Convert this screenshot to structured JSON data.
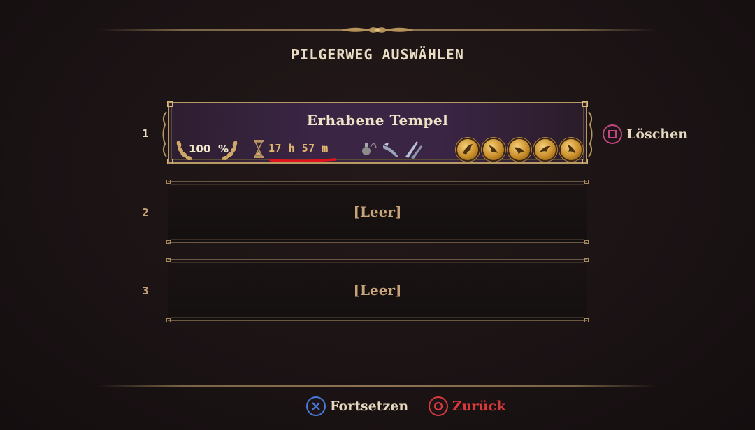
{
  "screen": {
    "title": "PILGERWEG AUSWÄHLEN"
  },
  "slots": [
    {
      "number": "1",
      "title": "Erhabene Tempel",
      "completion_value": "100",
      "completion_unit": "%",
      "playtime": "17 h 57 m",
      "icons": {
        "completion": "laurel-wreath-icon",
        "time": "hourglass-icon",
        "items": [
          "censer-icon",
          "claw-blade-icon",
          "twin-blades-icon"
        ],
        "medals": [
          "golden-bird-medal-icon",
          "golden-bird-medal-icon",
          "golden-bird-medal-icon",
          "golden-bird-medal-icon",
          "golden-bird-medal-icon"
        ]
      }
    },
    {
      "number": "2",
      "label": "[Leer]"
    },
    {
      "number": "3",
      "label": "[Leer]"
    }
  ],
  "prompts": {
    "delete": {
      "label": "Löschen",
      "button": "square-button-icon"
    },
    "continue": {
      "label": "Fortsetzen",
      "button": "cross-button-icon"
    },
    "back": {
      "label": "Zurück",
      "button": "circle-button-icon"
    }
  },
  "colors": {
    "accent_gold": "#e0b66e",
    "selected_bg": "#3a2545",
    "empty_label": "#c9a37a",
    "square_button": "#c0477f",
    "cross_button": "#4a79d8",
    "circle_button": "#d8393a",
    "annotation_underline": "#e0141a"
  }
}
